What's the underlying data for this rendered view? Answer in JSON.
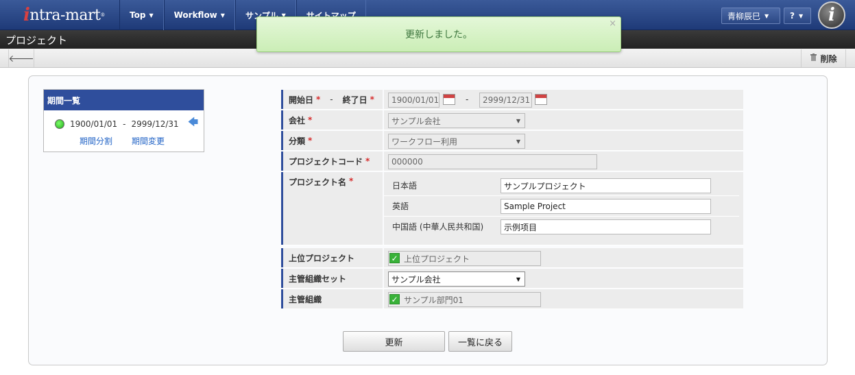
{
  "header": {
    "logo_i": "i",
    "logo_rest": "ntra-mart",
    "logo_mark": "®",
    "nav": [
      {
        "label": "Top",
        "caret": "▼"
      },
      {
        "label": "Workflow",
        "caret": "▼"
      },
      {
        "label": "サンプル",
        "caret": "▼"
      },
      {
        "label": "サイトマップ",
        "caret": ""
      }
    ],
    "user_name": "青柳辰巳",
    "help_label": "?",
    "brand_letter": "i"
  },
  "page": {
    "title": "プロジェクト",
    "delete_label": "削除"
  },
  "notification": {
    "message": "更新しました。",
    "close": "×"
  },
  "periods": {
    "heading": "期間一覧",
    "range_start": "1900/01/01",
    "range_sep": "-",
    "range_end": "2999/12/31",
    "split_label": "期間分割",
    "change_label": "期間変更"
  },
  "form": {
    "start_label": "開始日",
    "date_sep": "-",
    "end_label": "終了日",
    "start_value": "1900/01/01",
    "end_value": "2999/12/31",
    "company_label": "会社",
    "company_value": "サンプル会社",
    "category_label": "分類",
    "category_value": "ワークフロー利用",
    "code_label": "プロジェクトコード",
    "code_value": "000000",
    "name_label": "プロジェクト名",
    "name_rows": [
      {
        "lang": "日本語",
        "value": "サンプルプロジェクト"
      },
      {
        "lang": "英語",
        "value": "Sample Project"
      },
      {
        "lang": "中国語 (中華人民共和国)",
        "value": "示例项目"
      }
    ],
    "parent_label": "上位プロジェクト",
    "parent_value": "上位プロジェクト",
    "org_set_label": "主管組織セット",
    "org_set_value": "サンプル会社",
    "org_label": "主管組織",
    "org_value": "サンプル部門01",
    "required_mark": "*"
  },
  "actions": {
    "update": "更新",
    "back_to_list": "一覧に戻る"
  }
}
